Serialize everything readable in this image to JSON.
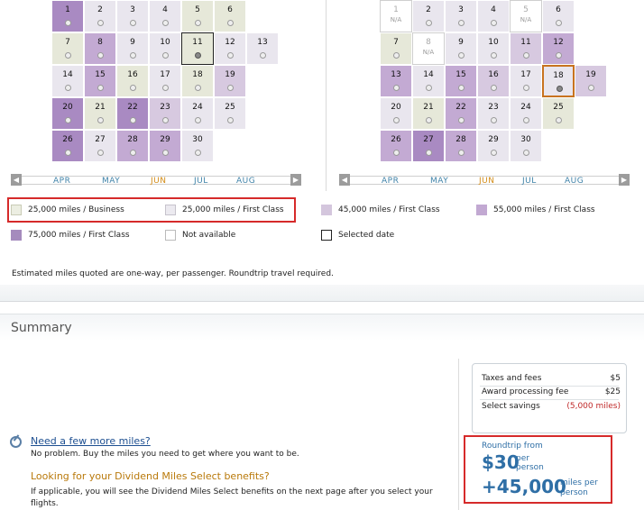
{
  "calendar_left": {
    "rows": [
      [
        {
          "d": "1",
          "c": "c-75"
        },
        {
          "d": "2",
          "c": "c-first25"
        },
        {
          "d": "3",
          "c": "c-first25"
        },
        {
          "d": "4",
          "c": "c-first25"
        },
        {
          "d": "5",
          "c": "c-business"
        },
        {
          "d": "6",
          "c": "c-business"
        }
      ],
      [
        {
          "d": "7",
          "c": "c-business"
        },
        {
          "d": "8",
          "c": "c-55"
        },
        {
          "d": "9",
          "c": "c-first25"
        },
        {
          "d": "10",
          "c": "c-first25"
        },
        {
          "d": "11",
          "c": "c-business",
          "sel": true
        },
        {
          "d": "12",
          "c": "c-first25"
        },
        {
          "d": "13",
          "c": "c-first25"
        }
      ],
      [
        {
          "d": "14",
          "c": "c-first25"
        },
        {
          "d": "15",
          "c": "c-55"
        },
        {
          "d": "16",
          "c": "c-business"
        },
        {
          "d": "17",
          "c": "c-first25"
        },
        {
          "d": "18",
          "c": "c-business"
        },
        {
          "d": "19",
          "c": "c-45"
        }
      ],
      [
        {
          "d": "20",
          "c": "c-75"
        },
        {
          "d": "21",
          "c": "c-business"
        },
        {
          "d": "22",
          "c": "c-75"
        },
        {
          "d": "23",
          "c": "c-45"
        },
        {
          "d": "24",
          "c": "c-first25"
        },
        {
          "d": "25",
          "c": "c-first25"
        }
      ],
      [
        {
          "d": "26",
          "c": "c-75"
        },
        {
          "d": "27",
          "c": "c-first25"
        },
        {
          "d": "28",
          "c": "c-55"
        },
        {
          "d": "29",
          "c": "c-55"
        },
        {
          "d": "30",
          "c": "c-first25"
        }
      ]
    ],
    "months": [
      "APR",
      "MAY",
      "JUN",
      "JUL",
      "AUG"
    ]
  },
  "calendar_right": {
    "rows": [
      [
        {
          "d": "1",
          "c": "c-na",
          "na": "N/A"
        },
        {
          "d": "2",
          "c": "c-first25"
        },
        {
          "d": "3",
          "c": "c-first25"
        },
        {
          "d": "4",
          "c": "c-first25"
        },
        {
          "d": "5",
          "c": "c-na",
          "na": "N/A"
        },
        {
          "d": "6",
          "c": "c-first25"
        }
      ],
      [
        {
          "d": "7",
          "c": "c-business"
        },
        {
          "d": "8",
          "c": "c-na",
          "na": "N/A"
        },
        {
          "d": "9",
          "c": "c-first25"
        },
        {
          "d": "10",
          "c": "c-first25"
        },
        {
          "d": "11",
          "c": "c-45"
        },
        {
          "d": "12",
          "c": "c-55"
        }
      ],
      [
        {
          "d": "13",
          "c": "c-55"
        },
        {
          "d": "14",
          "c": "c-first25"
        },
        {
          "d": "15",
          "c": "c-55"
        },
        {
          "d": "16",
          "c": "c-45"
        },
        {
          "d": "17",
          "c": "c-first25"
        },
        {
          "d": "18",
          "c": "c-first25",
          "selo": true
        },
        {
          "d": "19",
          "c": "c-45"
        }
      ],
      [
        {
          "d": "20",
          "c": "c-first25"
        },
        {
          "d": "21",
          "c": "c-business"
        },
        {
          "d": "22",
          "c": "c-55"
        },
        {
          "d": "23",
          "c": "c-first25"
        },
        {
          "d": "24",
          "c": "c-first25"
        },
        {
          "d": "25",
          "c": "c-business"
        }
      ],
      [
        {
          "d": "26",
          "c": "c-55"
        },
        {
          "d": "27",
          "c": "c-75"
        },
        {
          "d": "28",
          "c": "c-55"
        },
        {
          "d": "29",
          "c": "c-first25"
        },
        {
          "d": "30",
          "c": "c-first25"
        }
      ]
    ],
    "months": [
      "APR",
      "MAY",
      "JUN",
      "JUL",
      "AUG"
    ]
  },
  "legend": {
    "business": "25,000 miles / Business",
    "first25": "25,000 miles / First Class",
    "first45": "45,000 miles / First Class",
    "first55": "55,000 miles / First Class",
    "first75": "75,000 miles / First Class",
    "na": "Not available",
    "selected": "Selected date"
  },
  "note": "Estimated miles quoted are one-way, per passenger. Roundtrip travel required.",
  "summary": {
    "title": "Summary",
    "more_miles_link": "Need a few more miles?",
    "more_miles_text": "No problem. Buy the miles you need to get where you want to be.",
    "dm_head": "Looking for your Dividend Miles Select benefits?",
    "dm_text": "If applicable, you will see the Dividend Miles Select benefits on the next page after you select your flights."
  },
  "fees": {
    "taxes_label": "Taxes and fees",
    "taxes_value": "$5",
    "award_label": "Award processing fee",
    "award_value": "$25",
    "savings_label": "Select savings",
    "savings_value": "(5,000 miles)"
  },
  "total": {
    "roundtrip_from": "Roundtrip from",
    "price": "$30",
    "price_per": "per person",
    "miles": "+45,000",
    "miles_per": "miles per person"
  }
}
